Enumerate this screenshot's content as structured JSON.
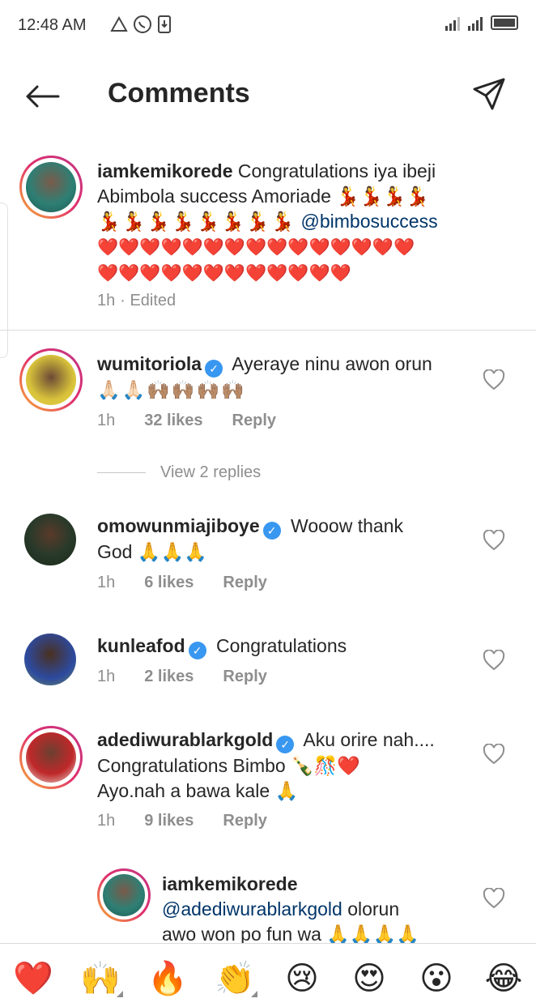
{
  "status_bar": {
    "time": "12:48 AM"
  },
  "header": {
    "title": "Comments"
  },
  "comments": [
    {
      "username": "iamkemikorede",
      "text_line1": "Congratulations iya ibeji",
      "text_line2": "Abimbola success Amoriade 💃💃💃💃",
      "text_line3_emojis": "💃💃💃💃💃💃💃💃",
      "mention": "@bimbosuccess",
      "hearts_line1": "❤️❤️❤️❤️❤️❤️❤️❤️❤️❤️❤️❤️❤️❤️❤️",
      "hearts_line2": "❤️❤️❤️❤️❤️❤️❤️❤️❤️❤️❤️❤️",
      "time": "1h",
      "edited": "· Edited"
    },
    {
      "username": "wumitoriola",
      "verified": true,
      "text": "Ayeraye ninu awon orun",
      "text_line2": "🙏🏻🙏🏻🙌🏽🙌🏽🙌🏽🙌🏽",
      "time": "1h",
      "likes": "32 likes",
      "reply": "Reply"
    },
    {
      "username": "omowunmiajiboye",
      "verified": true,
      "text": "Wooow thank",
      "text_line2": "God 🙏🙏🙏",
      "time": "1h",
      "likes": "6 likes",
      "reply": "Reply"
    },
    {
      "username": "kunleafod",
      "verified": true,
      "text": "Congratulations",
      "time": "1h",
      "likes": "2 likes",
      "reply": "Reply"
    },
    {
      "username": "adediwurablarkgold",
      "verified": true,
      "text": "Aku orire nah....",
      "text_line2": "Congratulations Bimbo 🍾🎊❤️",
      "text_line3": "Ayo.nah a bawa kale 🙏",
      "time": "1h",
      "likes": "9 likes",
      "reply": "Reply"
    },
    {
      "username": "iamkemikorede",
      "mention": "@adediwurablarkgold",
      "text": "olorun",
      "text_line2": "awo won po fun wa 🙏🙏🙏🙏"
    }
  ],
  "view_replies": "View 2 replies",
  "emoji_bar": [
    "❤️",
    "🙌",
    "🔥",
    "👏",
    "😢",
    "😍",
    "😮",
    "😂"
  ],
  "colors": {
    "link": "#003569",
    "verified": "#3897f0",
    "meta": "#8e8e8e"
  }
}
